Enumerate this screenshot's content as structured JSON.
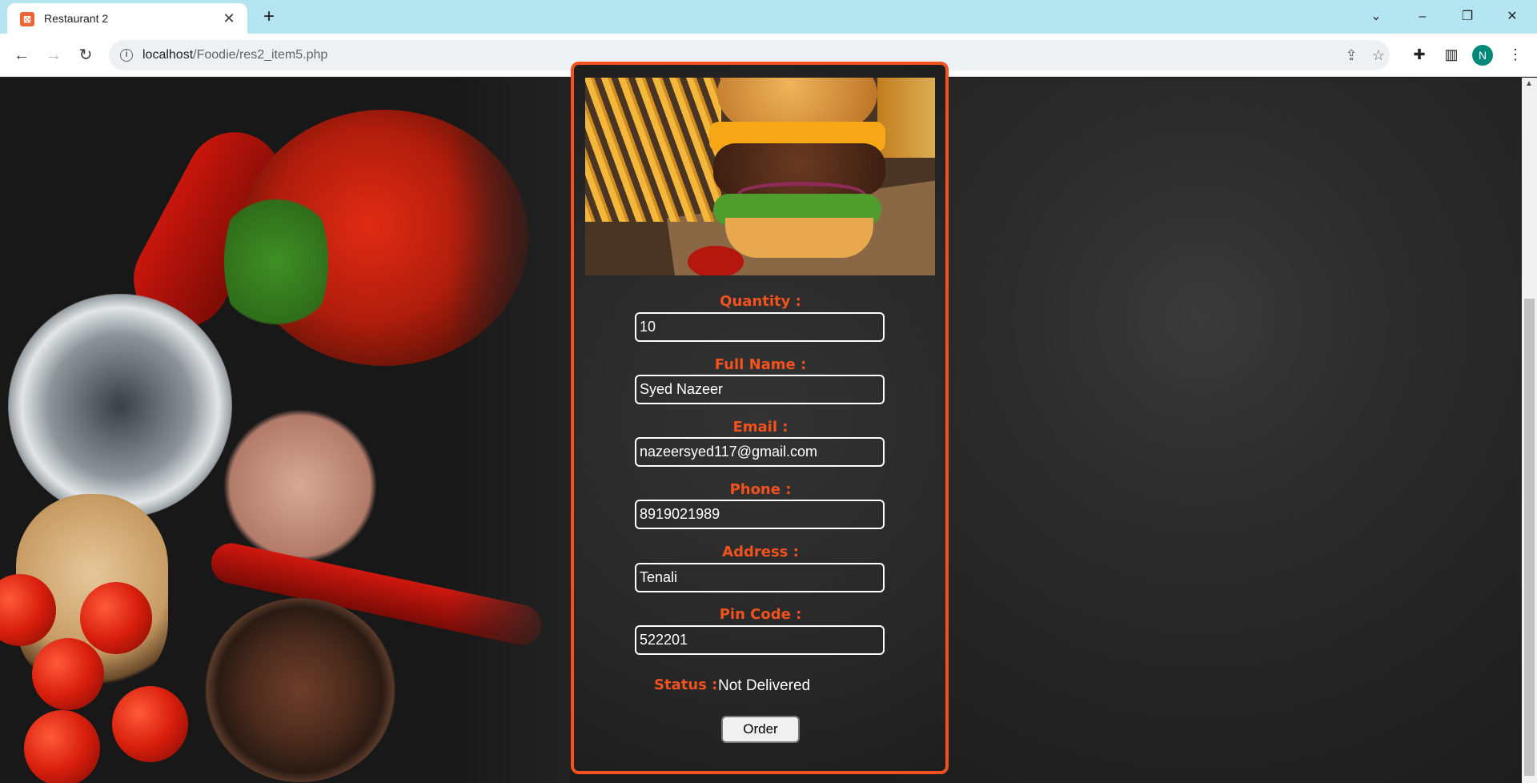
{
  "browser": {
    "tab_title": "Restaurant 2",
    "url_host": "localhost",
    "url_path": "/Foodie/res2_item5.php",
    "profile_initial": "N"
  },
  "form": {
    "quantity_label": "Quantity :",
    "quantity_value": "10",
    "fullname_label": "Full Name :",
    "fullname_value": "Syed Nazeer",
    "email_label": "Email :",
    "email_value": "nazeersyed117@gmail.com",
    "phone_label": "Phone :",
    "phone_value": "8919021989",
    "address_label": "Address :",
    "address_value": "Tenali",
    "pincode_label": "Pin Code :",
    "pincode_value": "522201",
    "status_label": "Status :",
    "status_value": "Not Delivered",
    "order_button": "Order"
  },
  "colors": {
    "accent": "#f4511e",
    "tabbar": "#b5e5f1",
    "avatar": "#00897b"
  },
  "icons": [
    "back-icon",
    "forward-icon",
    "reload-icon",
    "info-icon",
    "share-icon",
    "star-icon",
    "extensions-icon",
    "sidepanel-icon",
    "menu-icon",
    "close-icon",
    "new-tab-icon",
    "minimize-icon",
    "maximize-icon"
  ]
}
